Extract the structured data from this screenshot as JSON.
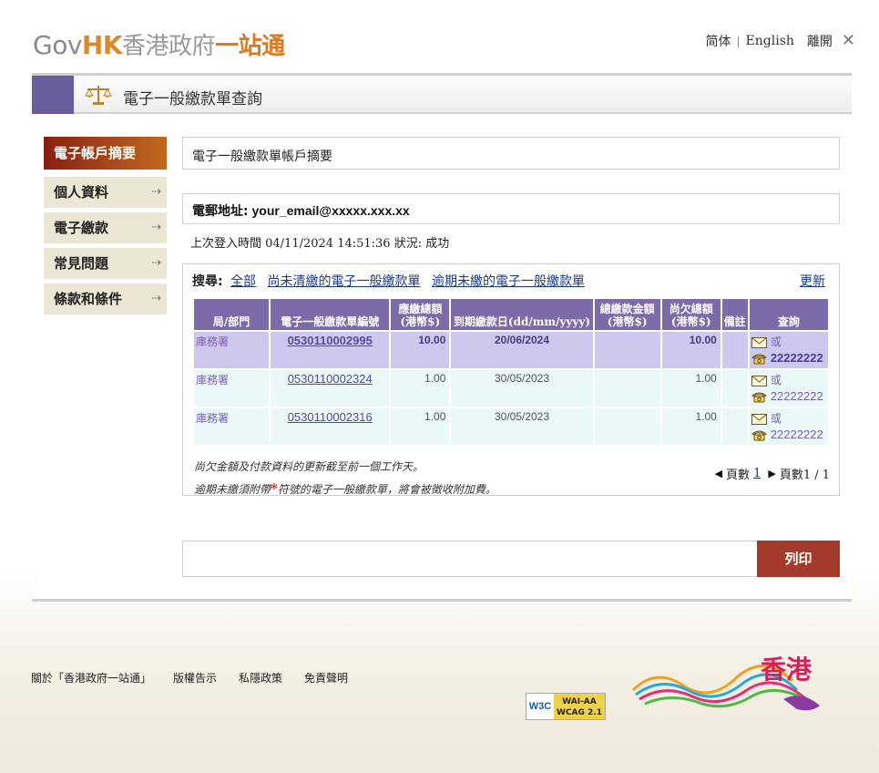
{
  "header": {
    "logo_gov": "Gov",
    "logo_hk": "HK",
    "logo_zh1": "香港政府",
    "logo_zh2": "一站通",
    "lang_simplified": "简体",
    "lang_english": "English",
    "logout": "離開",
    "close_glyph": "✕"
  },
  "page": {
    "title": "電子一般繳款單查詢"
  },
  "sidebar": {
    "items": [
      {
        "label": "電子帳戶摘要"
      },
      {
        "label": "個人資料"
      },
      {
        "label": "電子繳款"
      },
      {
        "label": "常見問題"
      },
      {
        "label": "條款和條件"
      }
    ]
  },
  "summary": {
    "title": "電子一般繳款單帳戶摘要"
  },
  "email": {
    "label": "電郵地址:",
    "value": "your_email@xxxxx.xxx.xx"
  },
  "login": {
    "text": "上次登入時間 04/11/2024 14:51:36 狀況: 成功"
  },
  "search": {
    "label": "搜尋:",
    "all": "全部",
    "unsettled": "尚未清繳的電子一般繳款單",
    "overdue": "逾期未繳的電子一般繳款單",
    "refresh": "更新"
  },
  "table": {
    "headers": [
      "局/部門",
      "電子一般繳款單編號",
      "應繳總額 (港幣$)",
      "到期繳款日(dd/mm/yyyy)",
      "總繳款金額 (港幣$)",
      "尚欠總額 (港幣$)",
      "備註",
      "查詢"
    ],
    "rows": [
      {
        "dept": "庫務署",
        "bill_no": "0530110002995",
        "amount": "10.00",
        "due": "20/06/2024",
        "paid": "",
        "outstanding": "10.00",
        "remark": "",
        "or": "或",
        "phone": "22222222"
      },
      {
        "dept": "庫務署",
        "bill_no": "0530110002324",
        "amount": "1.00",
        "due": "30/05/2023",
        "paid": "",
        "outstanding": "1.00",
        "remark": "",
        "or": "或",
        "phone": "22222222"
      },
      {
        "dept": "庫務署",
        "bill_no": "0530110002316",
        "amount": "1.00",
        "due": "30/05/2023",
        "paid": "",
        "outstanding": "1.00",
        "remark": "",
        "or": "或",
        "phone": "22222222"
      }
    ]
  },
  "notes": {
    "line1": "尚欠金額及付款資料的更新截至前一個工作天。",
    "line2_pre": "逾期未繳須附帶",
    "line2_star": "*",
    "line2_post": "符號的電子一般繳款單，將會被徵收附加費。"
  },
  "pager": {
    "page_label": "頁數",
    "current": "1",
    "total_text": "頁數1 / 1"
  },
  "actions": {
    "print": "列印"
  },
  "footer": {
    "links": [
      "關於「香港政府一站通」",
      "版權告示",
      "私隱政策",
      "免責聲明"
    ],
    "w3c": "W3C",
    "wai": "WAI-AA",
    "wcag": "WCAG 2.1",
    "brand": "香港"
  },
  "colors": {
    "accent_purple": "#7d6aa8",
    "active_nav_from": "#8a1f12",
    "active_nav_to": "#c06a1f",
    "print_button": "#a43b2a",
    "row_highlight": "#cdc8ed",
    "row_normal": "#eaf8f8"
  },
  "icons": {
    "title": "scales-icon",
    "email": "envelope-icon",
    "phone": "telephone-icon",
    "nav_arrow": "arrow-right-icon"
  }
}
